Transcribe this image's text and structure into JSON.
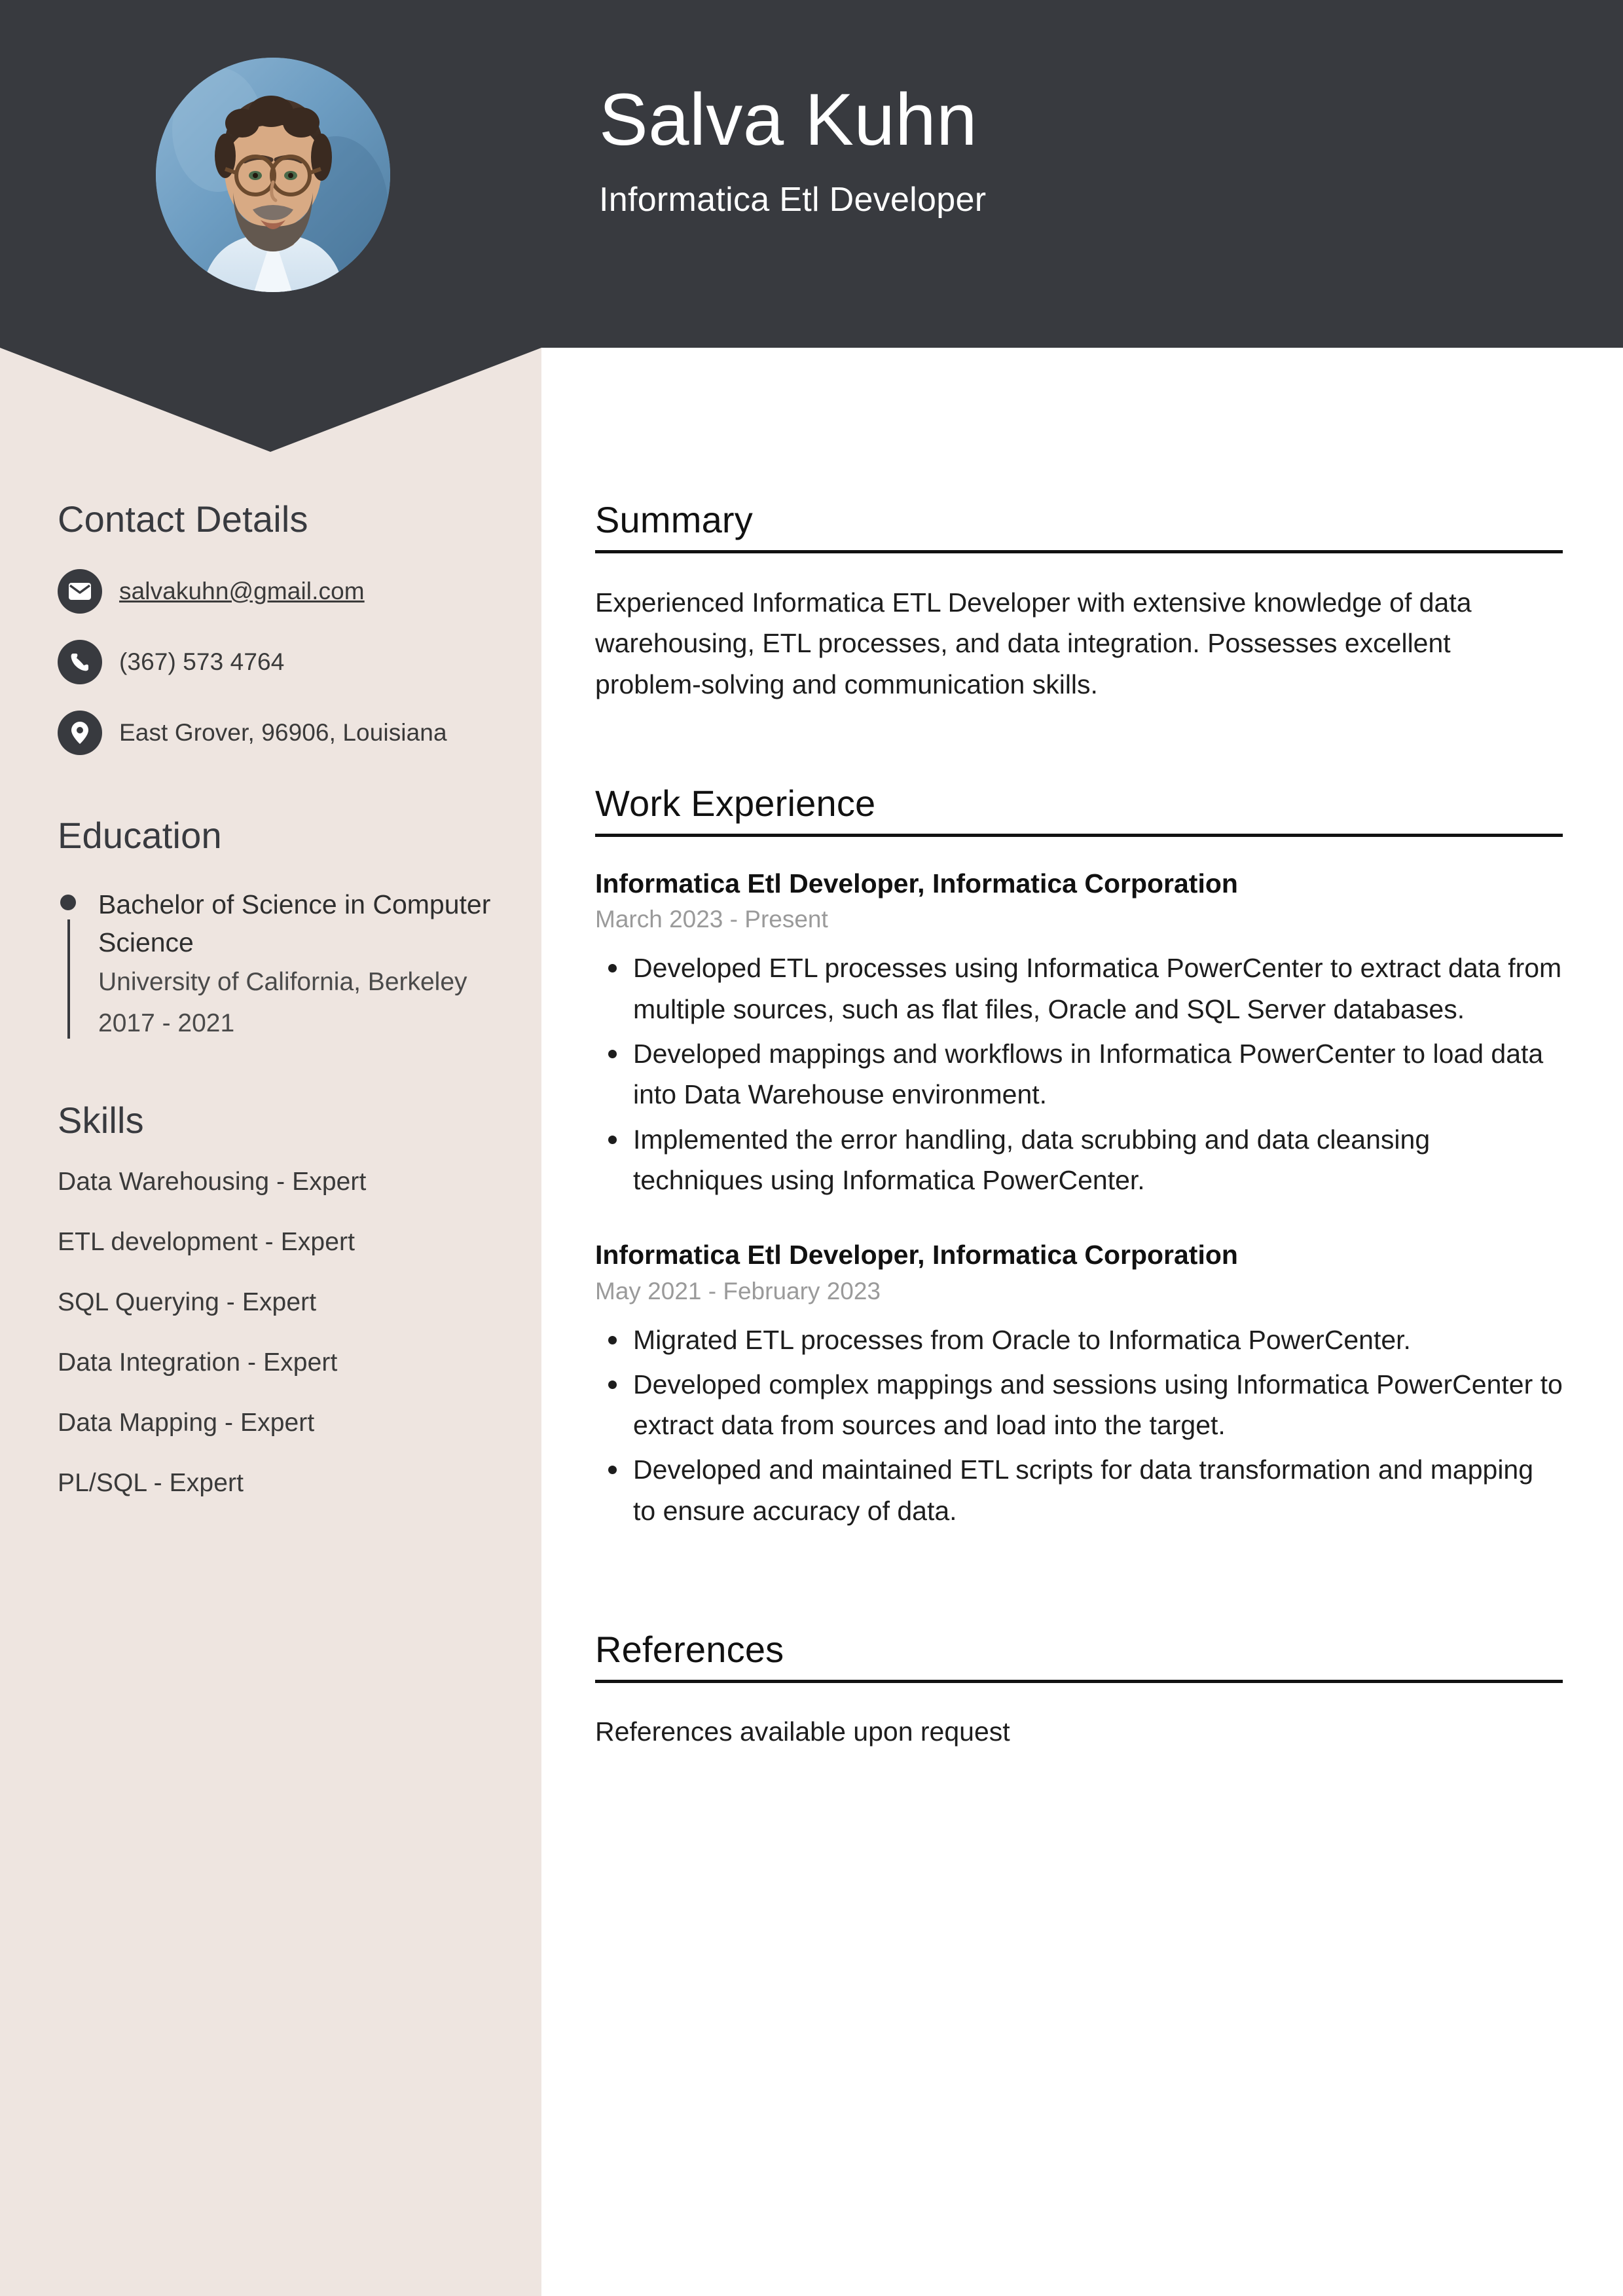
{
  "colors": {
    "header_bg": "#383A3F",
    "sidebar_bg": "#EEE5E0",
    "main_bg": "#FFFFFF",
    "text_dark": "#1D1D1D",
    "text_muted": "#9A9A9A"
  },
  "header": {
    "name": "Salva Kuhn",
    "role": "Informatica Etl Developer",
    "avatar_alt": "profile-photo"
  },
  "sidebar": {
    "contact": {
      "heading": "Contact Details",
      "items": [
        {
          "icon": "envelope-icon",
          "value": "salvakuhn@gmail.com",
          "is_link": true
        },
        {
          "icon": "phone-icon",
          "value": "(367) 573 4764",
          "is_link": false
        },
        {
          "icon": "location-pin-icon",
          "value": "East Grover, 96906, Louisiana",
          "is_link": false
        }
      ]
    },
    "education": {
      "heading": "Education",
      "items": [
        {
          "degree": "Bachelor of Science in Computer Science",
          "school": "University of California, Berkeley",
          "years": "2017 - 2021"
        }
      ]
    },
    "skills": {
      "heading": "Skills",
      "items": [
        "Data Warehousing - Expert",
        "ETL development - Expert",
        "SQL Querying - Expert",
        "Data Integration - Expert",
        "Data Mapping - Expert",
        "PL/SQL - Expert"
      ]
    }
  },
  "main": {
    "summary": {
      "heading": "Summary",
      "text": "Experienced Informatica ETL Developer with extensive knowledge of data warehousing, ETL processes, and data integration. Possesses excellent problem-solving and communication skills."
    },
    "work_experience": {
      "heading": "Work Experience",
      "jobs": [
        {
          "title": "Informatica Etl Developer, Informatica Corporation",
          "dates": "March 2023 - Present",
          "bullets": [
            "Developed ETL processes using Informatica PowerCenter to extract data from multiple sources, such as flat files, Oracle and SQL Server databases.",
            "Developed mappings and workflows in Informatica PowerCenter to load data into Data Warehouse environment.",
            "Implemented the error handling, data scrubbing and data cleansing techniques using Informatica PowerCenter."
          ]
        },
        {
          "title": "Informatica Etl Developer, Informatica Corporation",
          "dates": "May 2021 - February 2023",
          "bullets": [
            "Migrated ETL processes from Oracle to Informatica PowerCenter.",
            "Developed complex mappings and sessions using Informatica PowerCenter to extract data from sources and load into the target.",
            "Developed and maintained ETL scripts for data transformation and mapping to ensure accuracy of data."
          ]
        }
      ]
    },
    "references": {
      "heading": "References",
      "text": "References available upon request"
    }
  }
}
